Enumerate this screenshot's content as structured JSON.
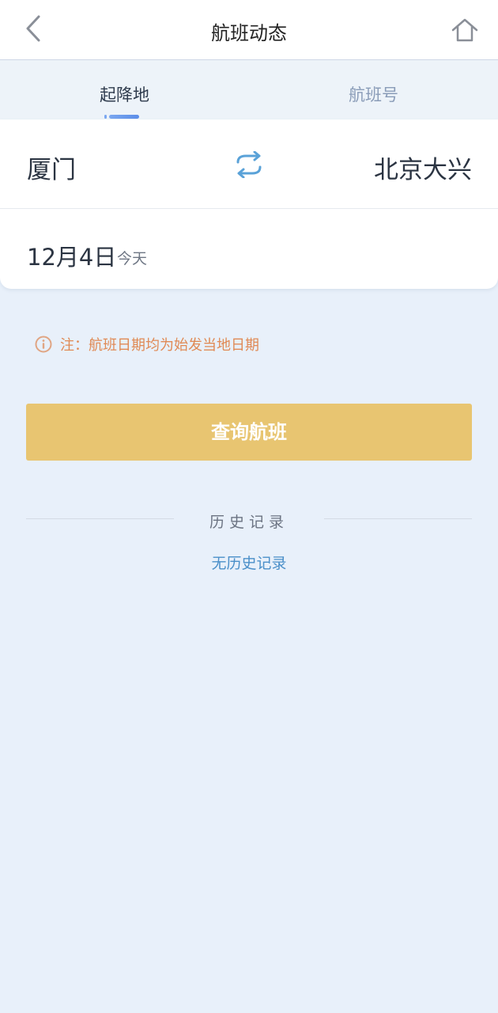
{
  "header": {
    "title": "航班动态",
    "back_icon": "chevron-left-icon",
    "home_icon": "home-icon"
  },
  "tabs": [
    {
      "label": "起降地",
      "active": true
    },
    {
      "label": "航班号",
      "active": false
    }
  ],
  "form": {
    "from_city": "厦门",
    "to_city": "北京大兴",
    "swap_icon": "swap-icon",
    "date": "12月4日",
    "date_sub": "今天"
  },
  "notice": {
    "icon": "info-icon",
    "text": "注：航班日期均为始发当地日期"
  },
  "query_button": {
    "label": "查询航班"
  },
  "history": {
    "title": "历史记录",
    "empty_text": "无历史记录"
  },
  "colors": {
    "accent_tab": "#5b8de8",
    "button": "#e8c571",
    "notice": "#e08a55",
    "link": "#4a8fc9",
    "page_bg": "#e8f0fa"
  }
}
